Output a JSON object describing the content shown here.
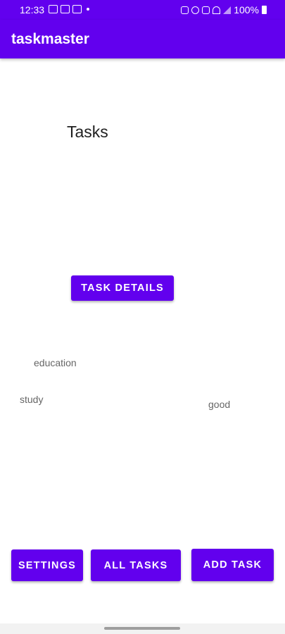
{
  "status_bar": {
    "time": "12:33",
    "battery_text": "100%",
    "icons_left": [
      "gallery-icon",
      "news-icon",
      "cast-icon"
    ],
    "icons_right": [
      "lock-icon",
      "alarm-icon",
      "mute-icon",
      "wifi-icon",
      "signal-icon",
      "battery-icon"
    ]
  },
  "app_bar": {
    "title": "taskmaster",
    "color": "#6200ee"
  },
  "main": {
    "heading": "Tasks",
    "task_details_label": "TASK DETAILS",
    "tasks": [
      {
        "title": "education"
      },
      {
        "title": "study"
      },
      {
        "title": "good"
      }
    ]
  },
  "bottom_buttons": {
    "settings_label": "SETTINGS",
    "all_tasks_label": "ALL TASKS",
    "add_task_label": "ADD TASK"
  }
}
